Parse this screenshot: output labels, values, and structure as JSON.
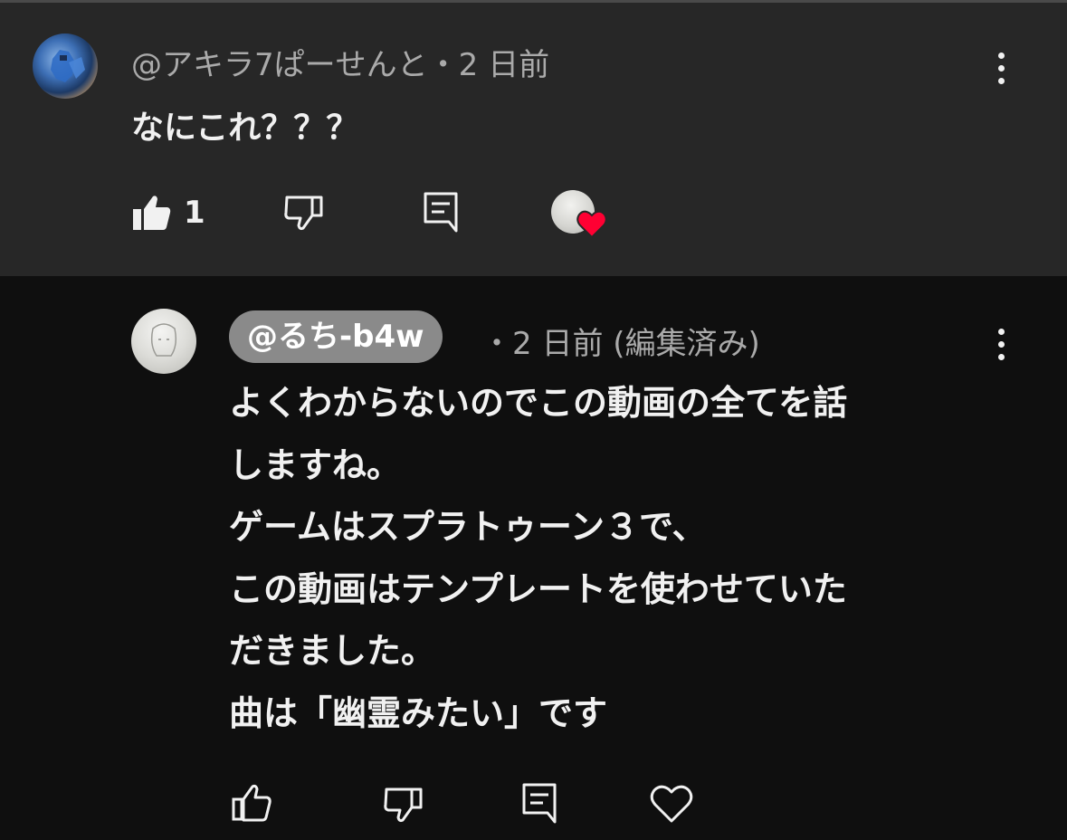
{
  "parent_comment": {
    "meta": "@アキラ7ぱーせんと・2 日前",
    "text": "なにこれ？？？",
    "like_count": "1"
  },
  "reply": {
    "mention": "@るち-b4w",
    "meta": "・2 日前 (編集済み)",
    "lines": [
      "よくわからないのでこの動画の全てを話",
      "しますね。",
      "ゲームはスプラトゥーン３で、",
      "この動画はテンプレートを使わせていた",
      "だきました。",
      "曲は「幽霊みたい」です"
    ]
  },
  "colors": {
    "parent_bg": "#272727",
    "page_bg": "#0f0f0f",
    "heart": "#ff0033",
    "mention_bg": "#8a8a8a"
  },
  "icons": {
    "like": "thumbs-up-icon",
    "dislike": "thumbs-down-icon",
    "reply": "comment-icon",
    "more": "more-vert-icon",
    "heart": "heart-icon"
  }
}
